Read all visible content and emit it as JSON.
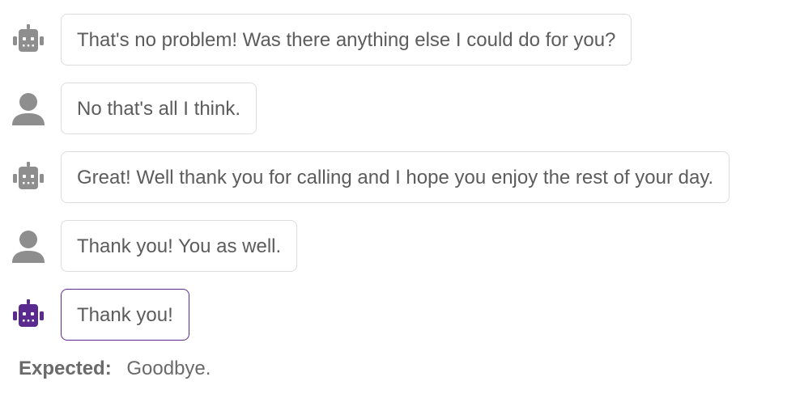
{
  "colors": {
    "bot_gray": "#8e8e8e",
    "user_gray": "#8e8e8e",
    "bot_active": "#5b2a8e",
    "bubble_border": "#dcdcdc",
    "highlight_border": "#5b2a8e"
  },
  "messages": [
    {
      "speaker": "bot",
      "icon": "robot-icon",
      "text": "That's no problem! Was there anything else I could do for you?"
    },
    {
      "speaker": "user",
      "icon": "user-icon",
      "text": "No that's all I think."
    },
    {
      "speaker": "bot",
      "icon": "robot-icon",
      "text": "Great! Well thank you for calling and I hope you enjoy the rest of your day."
    },
    {
      "speaker": "user",
      "icon": "user-icon",
      "text": "Thank you! You as well."
    },
    {
      "speaker": "bot",
      "icon": "robot-icon",
      "text": "Thank you!",
      "highlighted": true
    }
  ],
  "expected": {
    "label": "Expected:",
    "value": "Goodbye."
  }
}
